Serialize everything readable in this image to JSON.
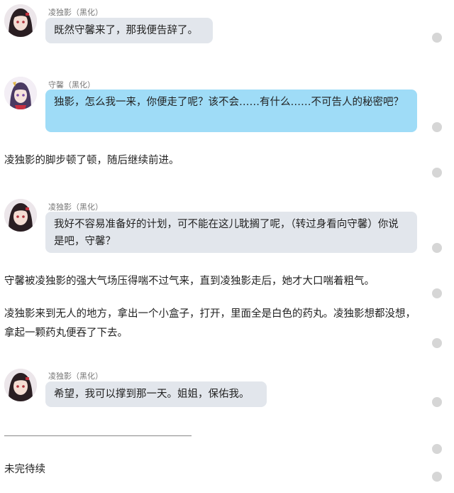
{
  "messages": [
    {
      "speaker": "凌独影（黑化）",
      "text": "既然守馨来了，那我便告辞了。"
    },
    {
      "speaker": "守馨（黑化）",
      "text": "独影，怎么我一来，你便走了呢？该不会……有什么……不可告人的秘密吧？"
    },
    {
      "speaker": "凌独影（黑化）",
      "text": "我好不容易准备好的计划，可不能在这儿耽搁了呢，（转过身看向守馨）你说是吧，守馨？"
    },
    {
      "speaker": "凌独影（黑化）",
      "text": "希望，我可以撑到那一天。姐姐，保佑我。"
    }
  ],
  "narration": [
    "凌独影的脚步顿了顿，随后继续前进。",
    "守馨被凌独影的强大气场压得喘不过气来，直到凌独影走后，她才大口喘着粗气。",
    "凌独影来到无人的地方，拿出一个小盒子，打开，里面全是白色的药丸。凌独影想都没想，拿起一颗药丸便吞了下去。"
  ],
  "footer": {
    "text": "未完待续"
  },
  "colors": {
    "gray_bubble": "#e2e6ec",
    "blue_bubble": "#9fdcf7"
  }
}
